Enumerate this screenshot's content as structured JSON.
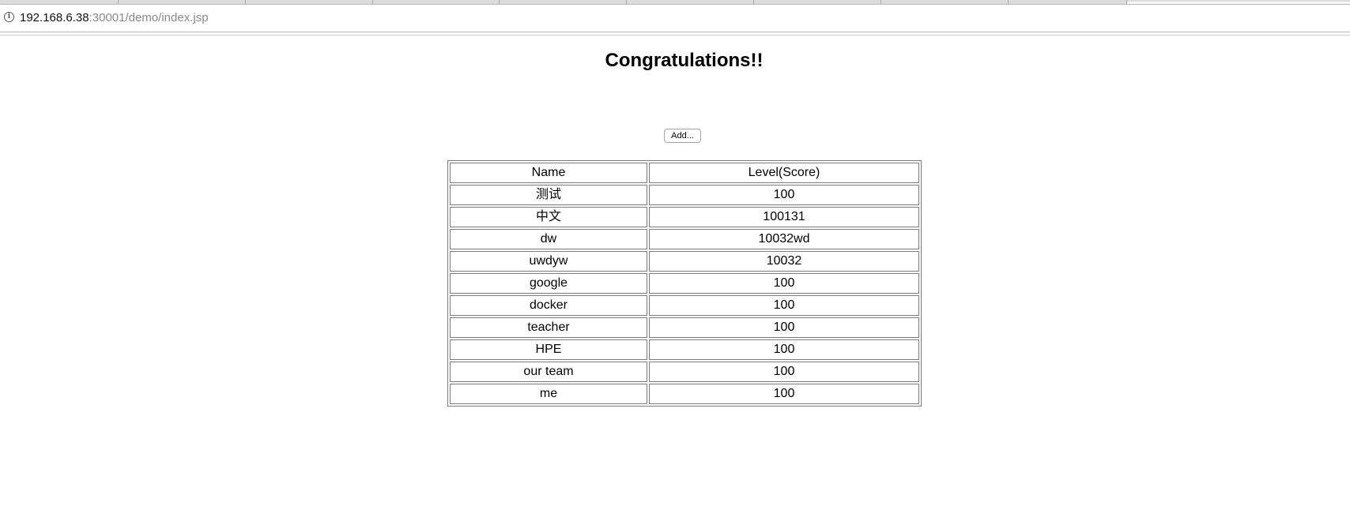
{
  "browser": {
    "address": {
      "host": "192.168.6.38",
      "path": ":30001/demo/index.jsp"
    }
  },
  "page": {
    "title": "Congratulations!!",
    "add_button_label": "Add...",
    "table": {
      "headers": [
        "Name",
        "Level(Score)"
      ],
      "rows": [
        {
          "name": "测试",
          "level": "100"
        },
        {
          "name": "中文",
          "level": "100131"
        },
        {
          "name": "dw",
          "level": "10032wd"
        },
        {
          "name": "uwdyw",
          "level": "10032"
        },
        {
          "name": "google",
          "level": "100"
        },
        {
          "name": "docker",
          "level": "100"
        },
        {
          "name": "teacher",
          "level": "100"
        },
        {
          "name": "HPE",
          "level": "100"
        },
        {
          "name": "our team",
          "level": "100"
        },
        {
          "name": "me",
          "level": "100"
        }
      ]
    }
  }
}
